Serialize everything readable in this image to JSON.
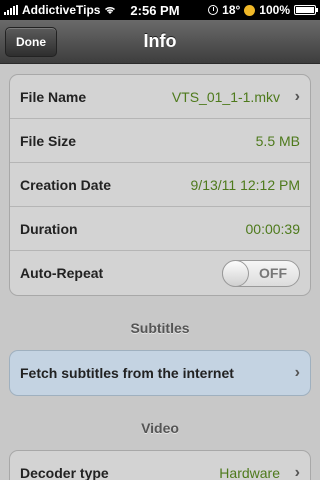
{
  "status_bar": {
    "carrier": "AddictiveTips",
    "time": "2:56 PM",
    "temperature": "18°",
    "battery": "100%",
    "battery_level": 1.0
  },
  "nav": {
    "done_label": "Done",
    "title": "Info"
  },
  "info": {
    "file_name_label": "File Name",
    "file_name_value": "VTS_01_1-1.mkv",
    "file_size_label": "File Size",
    "file_size_value": "5.5 MB",
    "creation_date_label": "Creation Date",
    "creation_date_value": "9/13/11 12:12 PM",
    "duration_label": "Duration",
    "duration_value": "00:00:39",
    "auto_repeat_label": "Auto-Repeat",
    "auto_repeat_state": "OFF"
  },
  "subtitles": {
    "header": "Subtitles",
    "fetch_label": "Fetch subtitles from the internet"
  },
  "video": {
    "header": "Video",
    "decoder_label": "Decoder type",
    "decoder_value": "Hardware"
  },
  "icons": [
    "signal-bars-icon",
    "wifi-icon",
    "clock-icon",
    "sun-icon",
    "battery-icon",
    "chevron-right-icon"
  ],
  "colors": {
    "value_green": "#4e7a1c",
    "highlight_blue": "#c4d3e2",
    "navbar": "#4a4a4a"
  }
}
